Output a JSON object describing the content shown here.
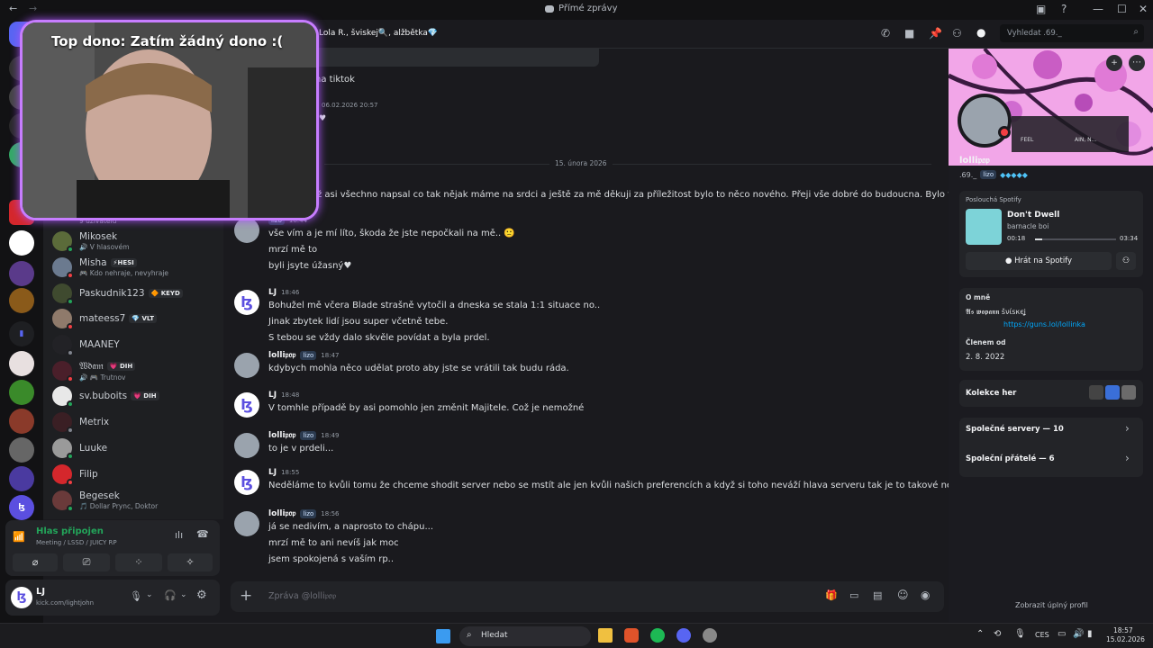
{
  "titlebar": {
    "title": "Přímé zprávy"
  },
  "header": {
    "recipients": "Lola R., šviskej🔍, alžbětka💎",
    "search_placeholder": "Vyhledat .69._"
  },
  "stream_overlay": {
    "top_dono": "Top dono: Zatím žádný dono :("
  },
  "members": [
    {
      "name": "Mikosek",
      "sub": "🔊 V hlasovém",
      "tag": "",
      "status": "#23a55a",
      "avatar": "#5b6b3a"
    },
    {
      "name": "Misha",
      "sub": "🎮 Kdo nehraje, nevyhraje",
      "tag": "⚡HESI",
      "status": "#f23f43",
      "avatar": "#6b7a8f"
    },
    {
      "name": "Paskudnik123",
      "sub": "",
      "tag": "🔶 KEYD",
      "status": "#23a55a",
      "avatar": "#3f4a2f"
    },
    {
      "name": "mateess7",
      "sub": "",
      "tag": "💎 VLT",
      "status": "#f23f43",
      "avatar": "#8f7a6b"
    },
    {
      "name": "MAANEY",
      "sub": "",
      "tag": "",
      "status": "#80848e",
      "avatar": "#222226"
    },
    {
      "name": "𝔚𝔡𝔞𝔪",
      "sub": "🔊 🎮 Trutnov",
      "tag": "💗 DIH",
      "status": "#f23f43",
      "avatar": "#4a1f2a"
    },
    {
      "name": "sv.buboits",
      "sub": "",
      "tag": "💗 DIH",
      "status": "#23a55a",
      "avatar": "#e8e8e8"
    },
    {
      "name": "Metrix",
      "sub": "",
      "tag": "",
      "status": "#80848e",
      "avatar": "#3a1f24"
    },
    {
      "name": "Luuke",
      "sub": "",
      "tag": "",
      "status": "#23a55a",
      "avatar": "#9a9a9a"
    },
    {
      "name": "Filip",
      "sub": "",
      "tag": "",
      "status": "#f23f43",
      "avatar": "#d4272c"
    },
    {
      "name": "Begesek",
      "sub": "🎵 Dollar Prync, Doktor",
      "tag": "",
      "status": "#23a55a",
      "avatar": "#6a3a3a"
    }
  ],
  "member_partial": {
    "sub": "9 uživatelů"
  },
  "voice": {
    "status": "Hlas připojen",
    "channel": "Meeting / LSSD / JUICY RP"
  },
  "user": {
    "name": "LJ",
    "status": "kick.com/lightjohn"
  },
  "chat": {
    "top_snippets": {
      "a": "na tiktok",
      "time": "06.02.2026 20:57"
    },
    "date_divider": "15. února 2026",
    "first_line": "ž asi všechno napsal co tak nějak máme na srdci a ještě za mě děkuji za příležitost bylo to něco nového. Přeji vše dobré do budoucna. Bylo to fajn.",
    "messages": [
      {
        "author": "",
        "badge": "lizo",
        "time": "18:44",
        "lines": [
          "vše vím a je mí líto, škoda že jste nepočkali na mě.. 🙁",
          "mrzí mě to",
          "byli jsyte úžasný♥"
        ],
        "avatar": "lollipop"
      },
      {
        "author": "LJ",
        "badge": "",
        "time": "18:46",
        "lines": [
          "Bohužel mě včera Blade strašně vytočil a dneska se stala 1:1 situace no..",
          "Jinak zbytek lidí jsou super včetně tebe.",
          "S tebou se vždy dalo skvěle povídat a byla prdel."
        ],
        "avatar": "lj"
      },
      {
        "author": "lolli𝔭𝔬𝔭",
        "badge": "lizo",
        "time": "18:47",
        "lines": [
          "kdybych mohla něco udělat proto aby jste se vrátili tak budu ráda."
        ],
        "avatar": "lollipop"
      },
      {
        "author": "LJ",
        "badge": "",
        "time": "18:48",
        "lines": [
          "V tomhle případě by asi pomohlo jen změnit Majitele. Což je nemožné"
        ],
        "avatar": "lj"
      },
      {
        "author": "lolli𝔭𝔬𝔭",
        "badge": "lizo",
        "time": "18:49",
        "lines": [
          "to je v prdeli..."
        ],
        "avatar": "lollipop"
      },
      {
        "author": "LJ",
        "badge": "",
        "time": "18:55",
        "lines": [
          "Neděláme to kvůli tomu že chceme shodit server nebo se mstít ale jen kvůli našich preferencích a když si toho neváží hlava serveru tak je to takové nepříjemné"
        ],
        "avatar": "lj"
      },
      {
        "author": "lolli𝔭𝔬𝔭",
        "badge": "lizo",
        "time": "18:56",
        "lines": [
          "já se nedivím, a naprosto to chápu...",
          "mrzí mě to ani nevíš jak moc",
          "jsem spokojená s vaším rp.."
        ],
        "avatar": "lollipop"
      }
    ],
    "composer_placeholder": "Zpráva @lolli𝔭𝔬𝔭"
  },
  "profile": {
    "name": "lolli𝔭𝔬𝔭",
    "handle": ".69._",
    "badge": "lizo",
    "spotify_label": "Poslouchá Spotify",
    "track": "Don't Dwell",
    "artist": "barnacle boi",
    "elapsed": "00:18",
    "duration": "03:34",
    "spotify_button": "Hrát na Spotify",
    "about_label": "O mně",
    "about_line1": "𝕬𝖘 𝖜𝖔𝖕𝖆𝖓𝖓 šνίѕкєʝ",
    "about_link": "https://guns.lol/lollinka",
    "member_since_label": "Členem od",
    "member_since": "2. 8. 2022",
    "collection_label": "Kolekce her",
    "servers_label": "Společné servery — 10",
    "friends_label": "Společní přátelé — 6",
    "full_profile": "Zobrazit úplný profil",
    "banner_text_a": "FEEL",
    "banner_text_b": "AIN, N..."
  },
  "taskbar": {
    "search": "Hledat",
    "lang": "CES",
    "time": "18:57",
    "date": "15.02.2026"
  }
}
